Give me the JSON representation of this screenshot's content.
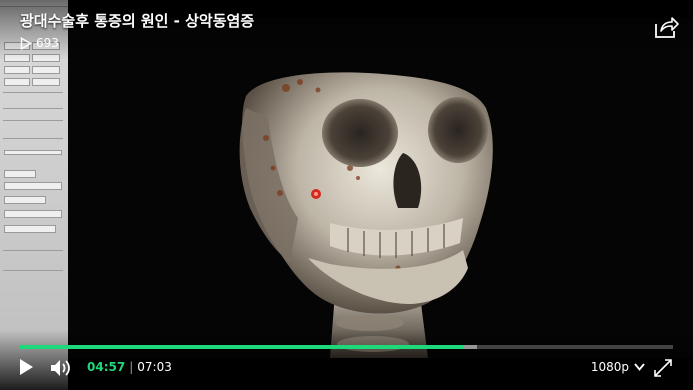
{
  "video": {
    "title": "광대수술후 통증의 원인 - 상악동염증",
    "view_count": "693",
    "progress": 0.6797,
    "buffered": 0.7,
    "current_time": "04:57",
    "duration": "07:03",
    "quality": "1080p"
  },
  "colors": {
    "accent": "#1ed97a",
    "bone": "#d9d4c8",
    "bone_shadow": "#6f6457",
    "blood_tint": "#7a3a1c"
  },
  "icons": {
    "play": "play-icon",
    "volume": "volume-icon",
    "share": "share-icon",
    "views": "play-outline-icon",
    "quality_caret": "chevron-down-icon",
    "fullscreen": "fullscreen-icon"
  }
}
